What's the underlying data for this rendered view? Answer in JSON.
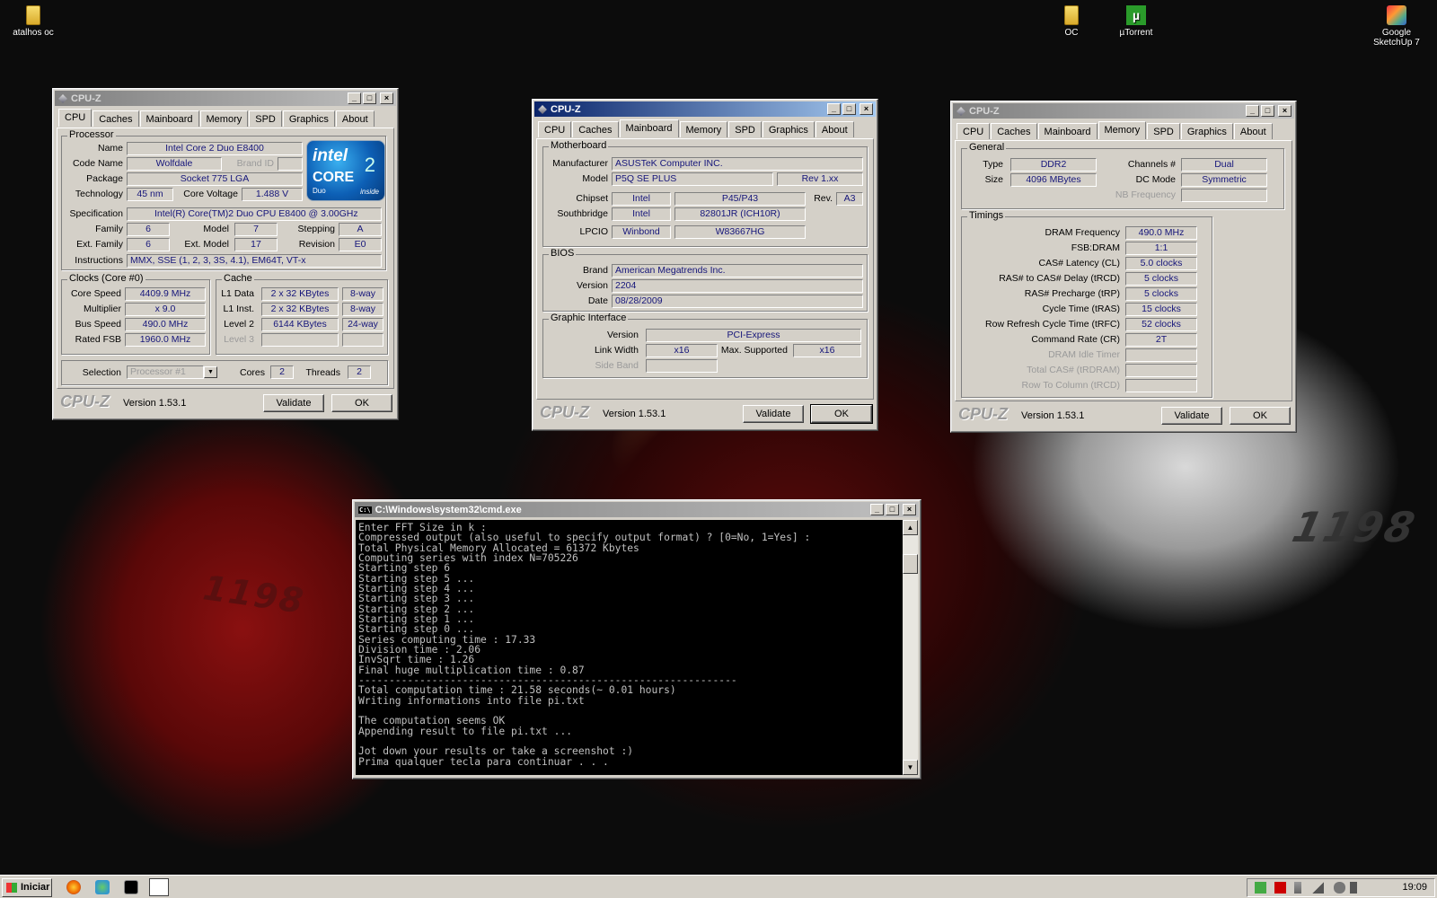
{
  "desktop": {
    "icons": [
      {
        "label": "atalhos oc"
      },
      {
        "label": "OC"
      },
      {
        "label": "µTorrent"
      },
      {
        "label": "Google SketchUp 7"
      }
    ],
    "wallpaper_text": "1198"
  },
  "cpuz_common": {
    "window_title": "CPU-Z",
    "brand": "CPU-Z",
    "version": "Version 1.53.1",
    "validate": "Validate",
    "ok": "OK",
    "tabs": [
      "CPU",
      "Caches",
      "Mainboard",
      "Memory",
      "SPD",
      "Graphics",
      "About"
    ]
  },
  "cpu": {
    "processor_group": "Processor",
    "name_label": "Name",
    "name": "Intel Core 2 Duo E8400",
    "codename_label": "Code Name",
    "codename": "Wolfdale",
    "brandid_label": "Brand ID",
    "package_label": "Package",
    "package": "Socket 775 LGA",
    "technology_label": "Technology",
    "technology": "45 nm",
    "corevoltage_label": "Core Voltage",
    "corevoltage": "1.488 V",
    "spec_label": "Specification",
    "spec": "Intel(R) Core(TM)2 Duo CPU     E8400  @ 3.00GHz",
    "family_label": "Family",
    "family": "6",
    "model_label": "Model",
    "model": "7",
    "stepping_label": "Stepping",
    "stepping": "A",
    "extfamily_label": "Ext. Family",
    "extfamily": "6",
    "extmodel_label": "Ext. Model",
    "extmodel": "17",
    "revision_label": "Revision",
    "revision": "E0",
    "instructions_label": "Instructions",
    "instructions": "MMX, SSE (1, 2, 3, 3S, 4.1), EM64T, VT-x",
    "intel_logo": {
      "t1": "intel",
      "t2": "CORE",
      "t3": "Duo",
      "t4": "inside",
      "t5": "2"
    },
    "clocks_group": "Clocks (Core #0)",
    "corespeed_label": "Core Speed",
    "corespeed": "4409.9 MHz",
    "multiplier_label": "Multiplier",
    "multiplier": "x 9.0",
    "busspeed_label": "Bus Speed",
    "busspeed": "490.0 MHz",
    "ratedfsb_label": "Rated FSB",
    "ratedfsb": "1960.0 MHz",
    "cache_group": "Cache",
    "l1d_label": "L1 Data",
    "l1d": "2 x 32 KBytes",
    "l1d_way": "8-way",
    "l1i_label": "L1 Inst.",
    "l1i": "2 x 32 KBytes",
    "l1i_way": "8-way",
    "l2_label": "Level 2",
    "l2": "6144 KBytes",
    "l2_way": "24-way",
    "l3_label": "Level 3",
    "selection_label": "Selection",
    "selection": "Processor #1",
    "cores_label": "Cores",
    "cores": "2",
    "threads_label": "Threads",
    "threads": "2"
  },
  "mainboard": {
    "group": "Motherboard",
    "manufacturer_label": "Manufacturer",
    "manufacturer": "ASUSTeK Computer INC.",
    "model_label": "Model",
    "model": "P5Q SE PLUS",
    "rev": "Rev 1.xx",
    "chipset_label": "Chipset",
    "chipset_vendor": "Intel",
    "chipset": "P45/P43",
    "rev_label": "Rev.",
    "chipset_rev": "A3",
    "south_label": "Southbridge",
    "south_vendor": "Intel",
    "south": "82801JR (ICH10R)",
    "lpcio_label": "LPCIO",
    "lpcio_vendor": "Winbond",
    "lpcio": "W83667HG",
    "bios_group": "BIOS",
    "brand_label": "Brand",
    "brand": "American Megatrends Inc.",
    "version_label": "Version",
    "version": "2204",
    "date_label": "Date",
    "date": "08/28/2009",
    "gi_group": "Graphic Interface",
    "gi_version_label": "Version",
    "gi_version": "PCI-Express",
    "linkwidth_label": "Link Width",
    "linkwidth": "x16",
    "maxsup_label": "Max. Supported",
    "maxsup": "x16",
    "sideband_label": "Side Band"
  },
  "memory": {
    "general_group": "General",
    "type_label": "Type",
    "type": "DDR2",
    "channels_label": "Channels #",
    "channels": "Dual",
    "size_label": "Size",
    "size": "4096 MBytes",
    "dcmode_label": "DC Mode",
    "dcmode": "Symmetric",
    "nbfreq_label": "NB Frequency",
    "timings_group": "Timings",
    "rows": [
      {
        "label": "DRAM Frequency",
        "value": "490.0 MHz",
        "dim": false
      },
      {
        "label": "FSB:DRAM",
        "value": "1:1",
        "dim": false
      },
      {
        "label": "CAS# Latency (CL)",
        "value": "5.0 clocks",
        "dim": false
      },
      {
        "label": "RAS# to CAS# Delay (tRCD)",
        "value": "5 clocks",
        "dim": false
      },
      {
        "label": "RAS# Precharge (tRP)",
        "value": "5 clocks",
        "dim": false
      },
      {
        "label": "Cycle Time (tRAS)",
        "value": "15 clocks",
        "dim": false
      },
      {
        "label": "Row Refresh Cycle Time (tRFC)",
        "value": "52 clocks",
        "dim": false
      },
      {
        "label": "Command Rate (CR)",
        "value": "2T",
        "dim": false
      },
      {
        "label": "DRAM Idle Timer",
        "value": "",
        "dim": true
      },
      {
        "label": "Total CAS# (tRDRAM)",
        "value": "",
        "dim": true
      },
      {
        "label": "Row To Column (tRCD)",
        "value": "",
        "dim": true
      }
    ]
  },
  "cmd": {
    "title": "C:\\Windows\\system32\\cmd.exe",
    "icon_text": "C:\\",
    "lines": [
      "Enter FFT Size in k :",
      "Compressed output (also useful to specify output format) ? [0=No, 1=Yes] :",
      "Total Physical Memory Allocated = 61372 Kbytes",
      "Computing series with index N=705226",
      "Starting step 6",
      "Starting step 5 ...",
      "Starting step 4 ...",
      "Starting step 3 ...",
      "Starting step 2 ...",
      "Starting step 1 ...",
      "Starting step 0 ...",
      "Series computing time : 17.33",
      "Division time : 2.06",
      "InvSqrt time : 1.26",
      "Final huge multiplication time : 0.87",
      "--------------------------------------------------------------",
      "Total computation time : 21.58 seconds(~ 0.01 hours)",
      "Writing informations into file pi.txt",
      "",
      "The computation seems OK",
      "Appending result to file pi.txt ...",
      "",
      "Jot down your results or take a screenshot :)",
      "Prima qualquer tecla para continuar . . ."
    ]
  },
  "taskbar": {
    "start_label": "Iniciar",
    "clock": "19:09"
  },
  "controls": {
    "min": "_",
    "max": "□",
    "close": "×",
    "up": "▲",
    "down": "▼",
    "dropdown": "▼"
  }
}
